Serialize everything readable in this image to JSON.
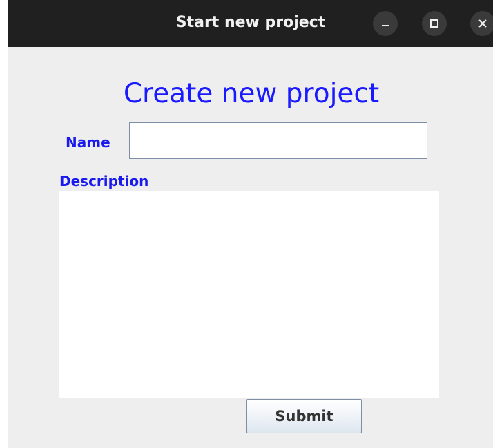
{
  "window": {
    "title": "Start new project",
    "controls": [
      "minimize-icon",
      "maximize-icon",
      "close-icon"
    ]
  },
  "form": {
    "heading": "Create new project",
    "name_label": "Name",
    "name_value": "",
    "description_label": "Description",
    "description_value": "",
    "submit_label": "Submit"
  },
  "colors": {
    "titlebar": "#202020",
    "background": "#eeeeee",
    "label_blue": "#1a1aee",
    "heading_blue": "#1a1aff"
  }
}
